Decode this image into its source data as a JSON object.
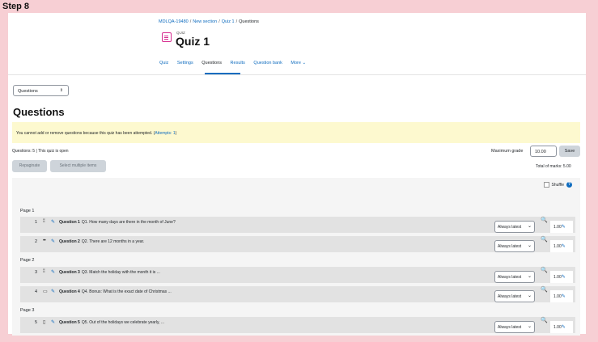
{
  "step_label": "Step 8",
  "breadcrumb": [
    "MDLQA-19480",
    "New section",
    "Quiz 1",
    "Questions"
  ],
  "breadcrumb_sep": "/",
  "quiz_small_label": "QUIZ",
  "quiz_title": "Quiz 1",
  "tabs": [
    {
      "label": "Quiz"
    },
    {
      "label": "Settings"
    },
    {
      "label": "Questions",
      "active": true
    },
    {
      "label": "Results"
    },
    {
      "label": "Question bank"
    },
    {
      "label": "More ⌄"
    }
  ],
  "view_select": {
    "value": "Questions"
  },
  "heading": "Questions",
  "warning": {
    "text": "You cannot add or remove questions because this quiz has been attempted. (",
    "link": "Attempts: 1",
    "end": ")"
  },
  "status_text": "Questions: 5 | This quiz is open",
  "max_grade": {
    "label": "Maximum grade",
    "value": "10.00",
    "save_label": "Save"
  },
  "repaginate_label": "Repaginate",
  "select_multiple_label": "Select multiple items",
  "total_marks": "Total of marks: 5.00",
  "shuffle_label": "Shuffle",
  "pages": [
    {
      "label": "Page 1"
    },
    {
      "label": "Page 2"
    },
    {
      "label": "Page 3"
    }
  ],
  "questions": [
    {
      "num": "1",
      "type_icon": "matching-icon",
      "name": "Question 1",
      "text": "Q1. How many days are there in the month of June?",
      "version": "Always latest",
      "mark": "1.00"
    },
    {
      "num": "2",
      "type_icon": "truefalse-icon",
      "name": "Question 2",
      "text": "Q2. There are 12 months in a year.",
      "version": "Always latest",
      "mark": "1.00"
    },
    {
      "num": "3",
      "type_icon": "matching-icon",
      "name": "Question 3",
      "text": "Q3. Match the holiday with the month it is ...",
      "version": "Always latest",
      "mark": "1.00"
    },
    {
      "num": "4",
      "type_icon": "shortanswer-icon",
      "name": "Question 4",
      "text": "Q4. Bonus: What is the exact date of Christmas ...",
      "version": "Always latest",
      "mark": "1.00"
    },
    {
      "num": "5",
      "type_icon": "multichoice-icon",
      "name": "Question 5",
      "text": "Q5. Out of the holidays we celebrate yearly, ...",
      "version": "Always latest",
      "mark": "1.00"
    }
  ],
  "colors": {
    "accent": "#0f6cbf",
    "warning_bg": "#fdf9cf",
    "frame": "#f7cfd4"
  }
}
